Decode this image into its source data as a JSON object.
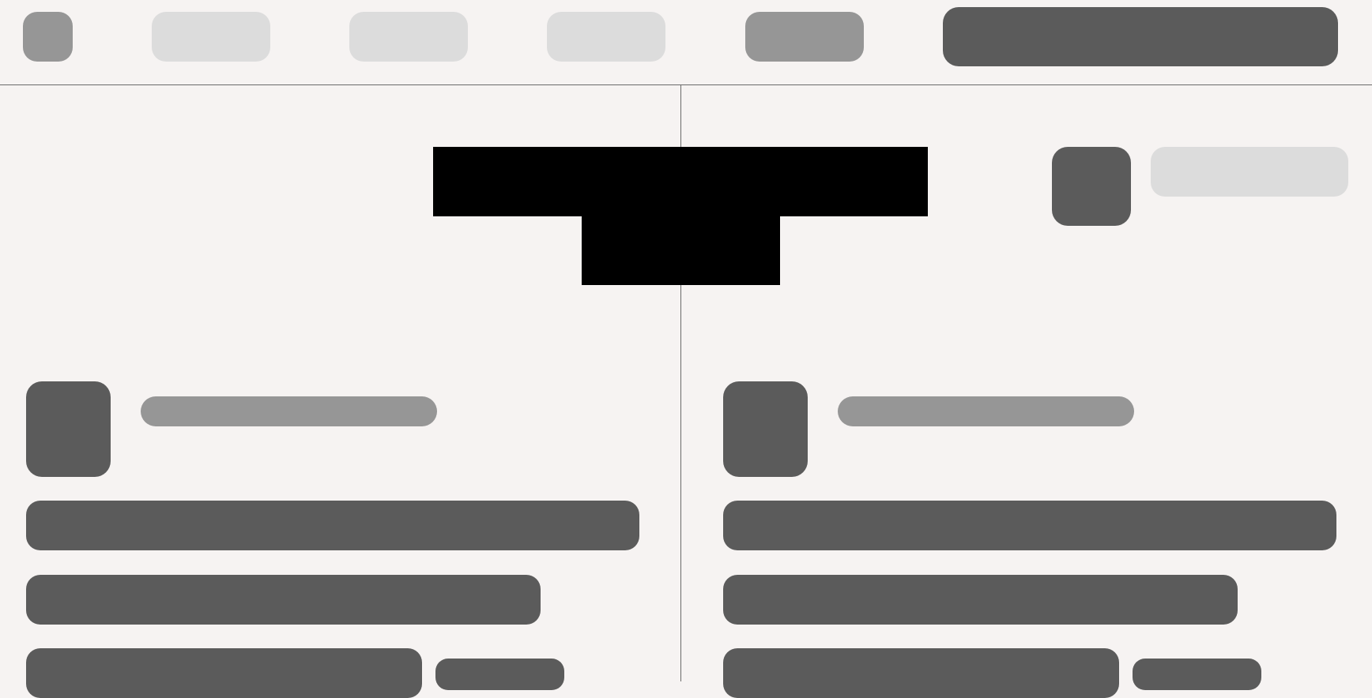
{
  "topbar": {
    "home": {
      "label": ""
    },
    "tabs": [
      {
        "label": ""
      },
      {
        "label": ""
      },
      {
        "label": ""
      },
      {
        "label": ""
      }
    ],
    "search": {
      "placeholder": ""
    }
  },
  "profile": {
    "name": ""
  },
  "cards": [
    {
      "title": "",
      "lines": [
        "",
        "",
        ""
      ],
      "tag": ""
    },
    {
      "title": "",
      "lines": [
        "",
        "",
        ""
      ],
      "tag": ""
    }
  ],
  "colors": {
    "background": "#f6f3f2",
    "placeholder_light": "#dcdcdc",
    "placeholder_medium": "#969696",
    "placeholder_dark": "#5b5b5b",
    "divider": "#6a6a6a",
    "redaction": "#000000"
  }
}
